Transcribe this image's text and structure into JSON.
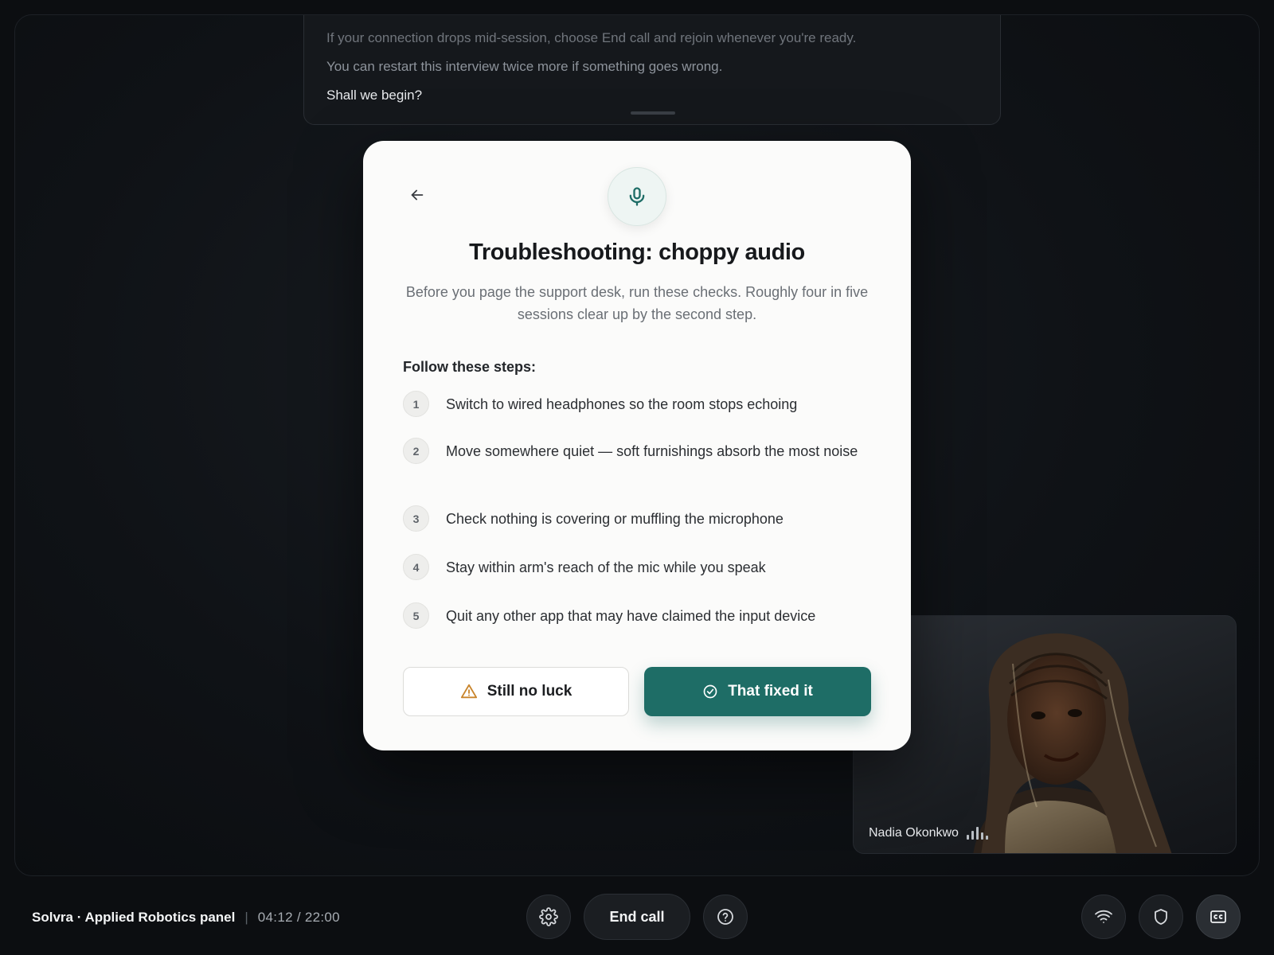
{
  "transcript": {
    "lines": [
      "If your connection drops mid-session, choose End call and rejoin whenever you're ready.",
      "You can restart this interview twice more if something goes wrong.",
      "Shall we begin?"
    ]
  },
  "participant": {
    "name": "Nadia Okonkwo"
  },
  "modal": {
    "title": "Troubleshooting: choppy audio",
    "subtitle": "Before you page the support desk, run these checks. Roughly four in five sessions clear up by the second step.",
    "steps_title": "Follow these steps:",
    "steps": [
      {
        "number": "1",
        "text": "Switch to wired headphones so the room stops echoing"
      },
      {
        "number": "2",
        "text": "Move somewhere quiet — soft furnishings absorb the most noise"
      },
      {
        "number": "3",
        "text": "Check nothing is covering or muffling the microphone"
      },
      {
        "number": "4",
        "text": "Stay within arm's reach of the mic while you speak"
      },
      {
        "number": "5",
        "text": "Quit any other app that may have claimed the input device"
      }
    ],
    "secondary_button": "Still no luck",
    "primary_button": "That fixed it",
    "icons": {
      "back": "arrow-left-icon",
      "header": "microphone-icon",
      "secondary": "warning-icon",
      "primary": "check-circle-icon"
    }
  },
  "bottombar": {
    "session_title": "Solvra · Applied Robotics panel",
    "separator": "|",
    "time": "04:12 / 22:00",
    "end_call_label": "End call",
    "icons": [
      "gear-icon",
      "help-icon",
      "wifi-icon",
      "shield-icon",
      "captions-icon"
    ]
  },
  "colors": {
    "accent": "#1e6d66",
    "background": "#0c0e11",
    "modal": "#fbfbfa",
    "warning": "#c9852c"
  }
}
